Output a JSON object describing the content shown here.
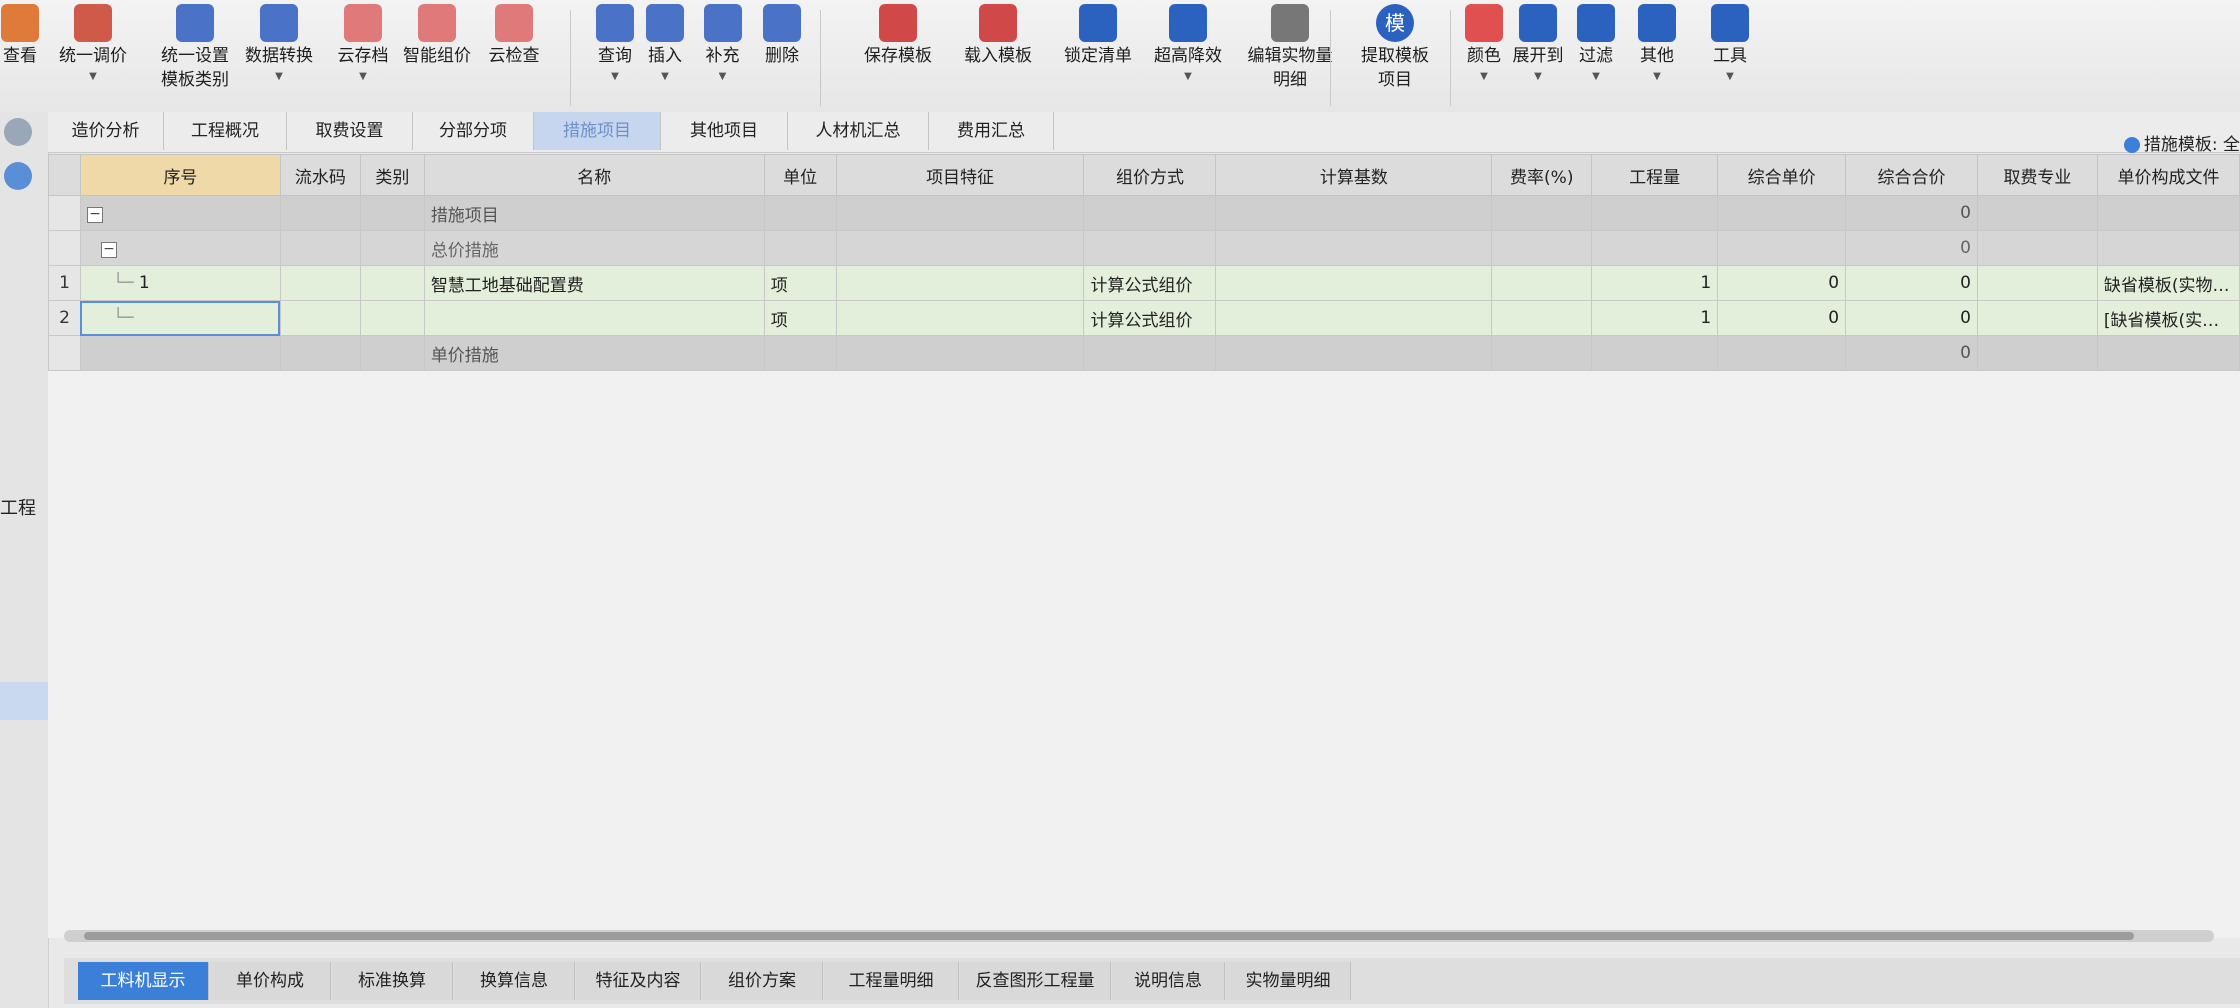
{
  "toolbar": {
    "items": [
      {
        "label": "查看",
        "sub": "",
        "dd": false
      },
      {
        "label": "统一调价",
        "sub": "",
        "dd": true
      },
      {
        "label": "统一设置",
        "sub": "模板类别",
        "dd": false
      },
      {
        "label": "数据转换",
        "sub": "",
        "dd": true
      },
      {
        "label": "云存档",
        "sub": "",
        "dd": true
      },
      {
        "label": "智能组价",
        "sub": "",
        "dd": false
      },
      {
        "label": "云检查",
        "sub": "",
        "dd": false
      },
      {
        "label": "查询",
        "sub": "",
        "dd": true
      },
      {
        "label": "插入",
        "sub": "",
        "dd": true
      },
      {
        "label": "补充",
        "sub": "",
        "dd": true
      },
      {
        "label": "删除",
        "sub": "",
        "dd": false
      },
      {
        "label": "保存模板",
        "sub": "",
        "dd": false
      },
      {
        "label": "载入模板",
        "sub": "",
        "dd": false
      },
      {
        "label": "锁定清单",
        "sub": "",
        "dd": false
      },
      {
        "label": "超高降效",
        "sub": "",
        "dd": true
      },
      {
        "label": "编辑实物量",
        "sub": "明细",
        "dd": false
      },
      {
        "label": "提取模板",
        "sub": "项目",
        "dd": false
      },
      {
        "label": "颜色",
        "sub": "",
        "dd": true
      },
      {
        "label": "展开到",
        "sub": "",
        "dd": true
      },
      {
        "label": "过滤",
        "sub": "",
        "dd": true
      },
      {
        "label": "其他",
        "sub": "",
        "dd": true
      },
      {
        "label": "工具",
        "sub": "",
        "dd": true
      }
    ],
    "template_glyph": "模"
  },
  "tabs": [
    "造价分析",
    "工程概况",
    "取费设置",
    "分部分项",
    "措施项目",
    "其他项目",
    "人材机汇总",
    "费用汇总"
  ],
  "active_tab": "措施项目",
  "right_indicator": "措施模板: 全",
  "left_gutter": {
    "label": "工程"
  },
  "table": {
    "columns": [
      "序号",
      "流水码",
      "类别",
      "名称",
      "单位",
      "项目特征",
      "组价方式",
      "计算基数",
      "费率(%)",
      "工程量",
      "综合单价",
      "综合合价",
      "取费专业",
      "单价构成文件"
    ],
    "rows": [
      {
        "kind": "grp",
        "rn": "",
        "seq": "",
        "name": "措施项目",
        "unit": "",
        "method": "",
        "qty": "",
        "price": "",
        "total": "0",
        "file": ""
      },
      {
        "kind": "sub",
        "rn": "",
        "seq": "",
        "name": "总价措施",
        "unit": "",
        "method": "",
        "qty": "",
        "price": "",
        "total": "0",
        "file": ""
      },
      {
        "kind": "item",
        "rn": "1",
        "seq": "1",
        "name": "智慧工地基础配置费",
        "unit": "项",
        "method": "计算公式组价",
        "qty": "1",
        "price": "0",
        "total": "0",
        "file": "缺省模板(实物…"
      },
      {
        "kind": "item",
        "rn": "2",
        "seq": "",
        "name": "",
        "unit": "项",
        "method": "计算公式组价",
        "qty": "1",
        "price": "0",
        "total": "0",
        "file": "[缺省模板(实…"
      },
      {
        "kind": "grp",
        "rn": "",
        "seq": "",
        "name": "单价措施",
        "unit": "",
        "method": "",
        "qty": "",
        "price": "",
        "total": "0",
        "file": ""
      }
    ]
  },
  "bottom_tabs": [
    "工料机显示",
    "单价构成",
    "标准换算",
    "换算信息",
    "特征及内容",
    "组价方案",
    "工程量明细",
    "反查图形工程量",
    "说明信息",
    "实物量明细"
  ],
  "active_bottom_tab": "工料机显示",
  "colors": {
    "accent": "#3c7fd8",
    "active_tab_bg": "#c6d6ef",
    "item_row": "#e3eedb"
  }
}
